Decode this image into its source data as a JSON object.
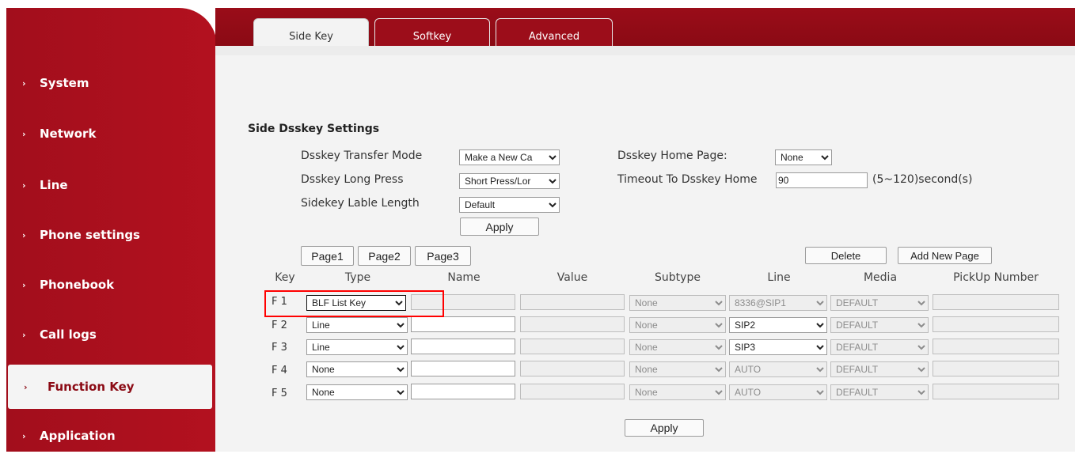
{
  "sidebar": {
    "items": [
      {
        "label": "System"
      },
      {
        "label": "Network"
      },
      {
        "label": "Line"
      },
      {
        "label": "Phone settings"
      },
      {
        "label": "Phonebook"
      },
      {
        "label": "Call logs"
      },
      {
        "label": "Function Key",
        "active": true
      },
      {
        "label": "Application"
      }
    ],
    "chevron": "›"
  },
  "tabs": [
    {
      "label": "Side Key",
      "active": true
    },
    {
      "label": "Softkey"
    },
    {
      "label": "Advanced"
    }
  ],
  "settings": {
    "title": "Side Dsskey Settings",
    "transfer_mode_label": "Dsskey Transfer Mode",
    "transfer_mode_value": "Make a New Ca",
    "long_press_label": "Dsskey Long Press",
    "long_press_value": "Short Press/Lor",
    "lable_length_label": "Sidekey Lable Length",
    "lable_length_value": "Default",
    "home_page_label": "Dsskey Home Page:",
    "home_page_value": "None",
    "timeout_label": "Timeout To Dsskey Home",
    "timeout_value": "90",
    "timeout_hint": "(5~120)second(s)",
    "apply_label": "Apply"
  },
  "pages": [
    "Page1",
    "Page2",
    "Page3"
  ],
  "page_actions": {
    "delete_label": "Delete",
    "add_label": "Add New Page"
  },
  "table": {
    "headers": [
      "Key",
      "Type",
      "Name",
      "Value",
      "Subtype",
      "Line",
      "Media",
      "PickUp Number"
    ],
    "rows": [
      {
        "key": "F 1",
        "type": "BLF List Key",
        "name": "",
        "value": "",
        "subtype": "None",
        "line": "8336@SIP1",
        "media": "DEFAULT",
        "pickup": ""
      },
      {
        "key": "F 2",
        "type": "Line",
        "name": "",
        "value": "",
        "subtype": "None",
        "line": "SIP2",
        "media": "DEFAULT",
        "pickup": ""
      },
      {
        "key": "F 3",
        "type": "Line",
        "name": "",
        "value": "",
        "subtype": "None",
        "line": "SIP3",
        "media": "DEFAULT",
        "pickup": ""
      },
      {
        "key": "F 4",
        "type": "None",
        "name": "",
        "value": "",
        "subtype": "None",
        "line": "AUTO",
        "media": "DEFAULT",
        "pickup": ""
      },
      {
        "key": "F 5",
        "type": "None",
        "name": "",
        "value": "",
        "subtype": "None",
        "line": "AUTO",
        "media": "DEFAULT",
        "pickup": ""
      }
    ]
  },
  "bottom_apply_label": "Apply",
  "colors": {
    "brand": "#a20e1c",
    "highlight": "#ff0000"
  }
}
